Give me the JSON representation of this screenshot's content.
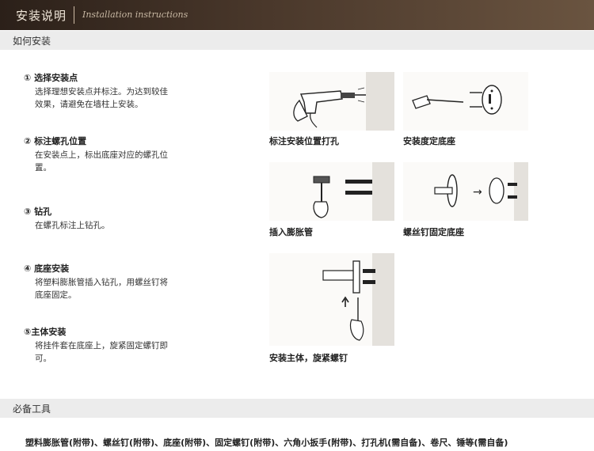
{
  "header": {
    "title": "安装说明",
    "subtitle": "Installation instructions"
  },
  "section_how": "如何安装",
  "steps": [
    {
      "heading": "① 选择安装点",
      "body": "选择理想安装点并标注。为达到较佳效果，请避免在墙柱上安装。"
    },
    {
      "heading": "② 标注螺孔位置",
      "body": "在安装点上，标出底座对应的螺孔位置。"
    },
    {
      "heading": "③ 钻孔",
      "body": "在螺孔标注上钻孔。"
    },
    {
      "heading": "④ 底座安装",
      "body": "将塑料膨胀管插入钻孔，用螺丝钉将底座固定。"
    },
    {
      "heading": "⑤主体安装",
      "body": "将挂件套在底座上，旋紧固定螺钉即可。"
    }
  ],
  "figures": [
    {
      "caption": "标注安装位置打孔",
      "icon": "drill-icon"
    },
    {
      "caption": "安装度定底座",
      "icon": "screwdriver-icon"
    },
    {
      "caption": "插入膨胀管",
      "icon": "hammer-icon"
    },
    {
      "caption": "螺丝钉固定底座",
      "icon": "base-mount-icon"
    },
    {
      "caption": "安装主体，旋紧螺钉",
      "icon": "towel-bar-icon"
    }
  ],
  "section_tools": "必备工具",
  "tools_text": "塑料膨胀管(附带)、螺丝钉(附带)、底座(附带)、固定螺钉(附带)、六角小扳手(附带)、打孔机(需自备)、卷尺、锤等(需自备)",
  "colors": {
    "header_dark": "#2b2019",
    "header_light": "#6a5440",
    "bar_bg": "#ececec"
  }
}
